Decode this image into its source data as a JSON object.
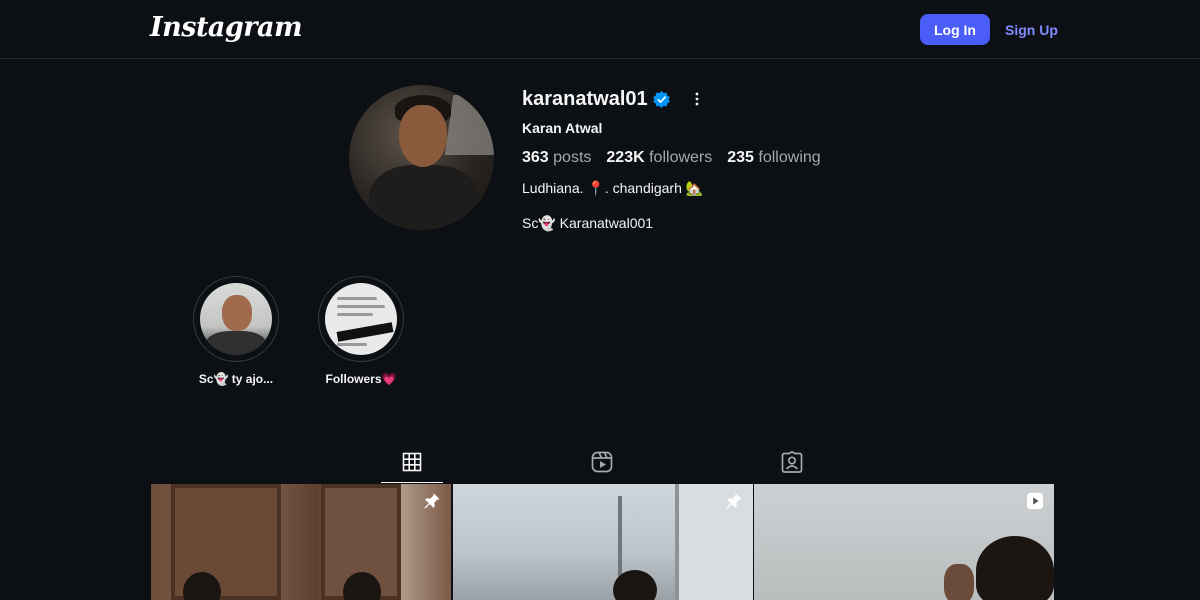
{
  "header": {
    "logo_text": "Instagram",
    "login_label": "Log In",
    "signup_label": "Sign Up"
  },
  "profile": {
    "username": "karanatwal01",
    "full_name": "Karan Atwal",
    "stats": {
      "posts_count": "363",
      "posts_label": "posts",
      "followers_count": "223K",
      "followers_label": "followers",
      "following_count": "235",
      "following_label": "following"
    },
    "bio": {
      "line1": "Ludhiana. 📍. chandigarh 🏡",
      "line2": "Sc👻 Karanatwal001"
    }
  },
  "highlights": [
    {
      "label": "Sc👻 ty ajo..."
    },
    {
      "label": "Followers💗"
    }
  ],
  "tabs": [
    {
      "icon": "grid-icon",
      "active": true
    },
    {
      "icon": "reels-icon",
      "active": false
    },
    {
      "icon": "tagged-icon",
      "active": false
    }
  ],
  "posts": [
    {
      "badge_icon": "pin-icon"
    },
    {
      "badge_icon": "pin-icon"
    },
    {
      "badge_icon": "reel-play-icon"
    }
  ],
  "colors": {
    "background": "#0c1014",
    "accent": "#4a5df9",
    "link": "#7f8dff",
    "verified": "#0095f6"
  }
}
